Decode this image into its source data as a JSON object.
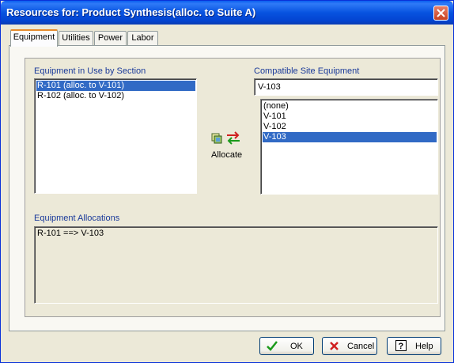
{
  "window": {
    "title": "Resources for: Product Synthesis(alloc. to Suite A)"
  },
  "tabs": [
    {
      "label": "Equipment",
      "active": true
    },
    {
      "label": "Utilities",
      "active": false
    },
    {
      "label": "Power",
      "active": false
    },
    {
      "label": "Labor",
      "active": false
    }
  ],
  "equipment_in_use": {
    "label": "Equipment in Use by Section",
    "items": [
      "R-101 (alloc. to V-101)",
      "R-102 (alloc. to V-102)"
    ],
    "selected_index": 0
  },
  "compatible": {
    "label": "Compatible Site Equipment",
    "field_value": "V-103",
    "items": [
      "(none)",
      "V-101",
      "V-102",
      "V-103"
    ],
    "selected_index": 3
  },
  "allocate": {
    "label": "Allocate",
    "icon": "allocate-icon"
  },
  "allocations": {
    "label": "Equipment Allocations",
    "items": [
      "R-101 ==> V-103"
    ]
  },
  "buttons": {
    "ok": "OK",
    "cancel": "Cancel",
    "help": "Help"
  },
  "colors": {
    "title_bar": "#0753e0",
    "selection": "#316ac5",
    "label": "#1a3a9a",
    "face": "#ece9d8"
  }
}
